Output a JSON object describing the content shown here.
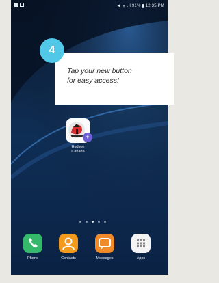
{
  "status_bar": {
    "right_text": "◄ ᯤ .ıl 91% ▮ 12:35 PM"
  },
  "callout": {
    "step_number": "4",
    "line1": "Tap your new button",
    "line2": "for easy access!"
  },
  "home_app": {
    "label_line1": "Hudson",
    "label_line2": "Canada",
    "badge_glyph": "+"
  },
  "dock": [
    {
      "label": "Phone",
      "icon": "phone-icon",
      "color": "#35b96b"
    },
    {
      "label": "Contacts",
      "icon": "contacts-icon",
      "color": "#f39a1c"
    },
    {
      "label": "Messages",
      "icon": "messages-icon",
      "color": "#f18b2a"
    },
    {
      "label": "Apps",
      "icon": "apps-grid-icon",
      "color": "#f4f4f4"
    }
  ],
  "page_dots": {
    "count": 5,
    "active_index": 2
  },
  "colors": {
    "accent": "#52c8e8",
    "badge": "#6d5fd6"
  }
}
